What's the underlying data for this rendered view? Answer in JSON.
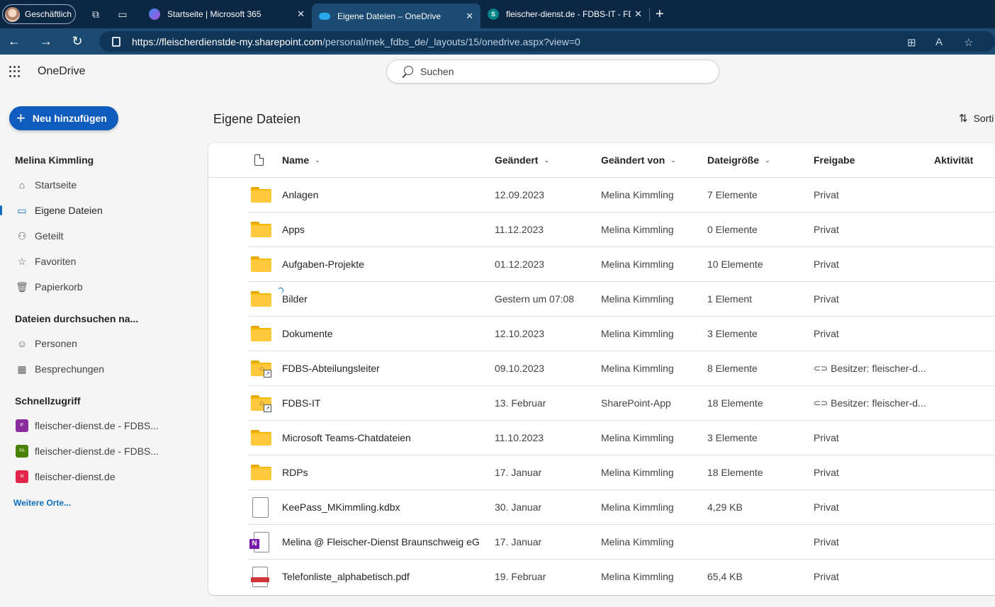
{
  "browser": {
    "profile_label": "Geschäftlich",
    "tabs": [
      {
        "title": "Startseite | Microsoft 365"
      },
      {
        "title": "Eigene Dateien – OneDrive"
      },
      {
        "title": "fleischer-dienst.de - FDBS-IT - FD"
      }
    ],
    "url_host": "https://fleischerdienstde-my.sharepoint.com",
    "url_path": "/personal/mek_fdbs_de/_layouts/15/onedrive.aspx?view=0"
  },
  "app": {
    "name": "OneDrive",
    "search_placeholder": "Suchen"
  },
  "sidebar": {
    "new_button": "Neu hinzufügen",
    "user_name": "Melina Kimmling",
    "items": [
      {
        "label": "Startseite",
        "icon": "home-icon"
      },
      {
        "label": "Eigene Dateien",
        "icon": "folder-icon",
        "active": true
      },
      {
        "label": "Geteilt",
        "icon": "people-icon"
      },
      {
        "label": "Favoriten",
        "icon": "star-icon"
      },
      {
        "label": "Papierkorb",
        "icon": "recycle-bin-icon"
      }
    ],
    "browse_header": "Dateien durchsuchen na...",
    "browse_items": [
      {
        "label": "Personen",
        "icon": "person-icon"
      },
      {
        "label": "Besprechungen",
        "icon": "calendar-icon"
      }
    ],
    "quick_header": "Schnellzugriff",
    "quick_items": [
      {
        "label": "fleischer-dienst.de - FDBS...",
        "badge": "fF",
        "color": "#8a2c9e"
      },
      {
        "label": "fleischer-dienst.de - FDBS...",
        "badge": "FA",
        "color": "#498205"
      },
      {
        "label": "fleischer-dienst.de",
        "badge": "fd",
        "color": "#e3244b"
      }
    ],
    "more_places": "Weitere Orte..."
  },
  "main": {
    "title": "Eigene Dateien",
    "sort_label": "Sorti",
    "columns": {
      "name": "Name",
      "modified": "Geändert",
      "modified_by": "Geändert von",
      "size": "Dateigröße",
      "sharing": "Freigabe",
      "activity": "Aktivität"
    },
    "files": [
      {
        "name": "Anlagen",
        "type": "folder",
        "modified": "12.09.2023",
        "by": "Melina Kimmling",
        "size": "7 Elemente",
        "sharing": "Privat"
      },
      {
        "name": "Apps",
        "type": "folder",
        "modified": "11.12.2023",
        "by": "Melina Kimmling",
        "size": "0 Elemente",
        "sharing": "Privat"
      },
      {
        "name": "Aufgaben-Projekte",
        "type": "folder",
        "modified": "01.12.2023",
        "by": "Melina Kimmling",
        "size": "10 Elemente",
        "sharing": "Privat"
      },
      {
        "name": "Bilder",
        "type": "folder",
        "modified": "Gestern um 07:08",
        "by": "Melina Kimmling",
        "size": "1 Element",
        "sharing": "Privat"
      },
      {
        "name": "Dokumente",
        "type": "folder",
        "modified": "12.10.2023",
        "by": "Melina Kimmling",
        "size": "3 Elemente",
        "sharing": "Privat"
      },
      {
        "name": "FDBS-Abteilungsleiter",
        "type": "shared-folder",
        "modified": "09.10.2023",
        "by": "Melina Kimmling",
        "size": "8 Elemente",
        "sharing": "Besitzer: fleischer-d..."
      },
      {
        "name": "FDBS-IT",
        "type": "shared-folder",
        "modified": "13. Februar",
        "by": "SharePoint-App",
        "size": "18 Elemente",
        "sharing": "Besitzer: fleischer-d..."
      },
      {
        "name": "Microsoft Teams-Chatdateien",
        "type": "folder",
        "modified": "11.10.2023",
        "by": "Melina Kimmling",
        "size": "3 Elemente",
        "sharing": "Privat"
      },
      {
        "name": "RDPs",
        "type": "folder",
        "modified": "17. Januar",
        "by": "Melina Kimmling",
        "size": "18 Elemente",
        "sharing": "Privat"
      },
      {
        "name": "KeePass_MKimmling.kdbx",
        "type": "file",
        "modified": "30. Januar",
        "by": "Melina Kimmling",
        "size": "4,29 KB",
        "sharing": "Privat"
      },
      {
        "name": "Melina @ Fleischer-Dienst Braunschweig eG",
        "type": "onenote",
        "modified": "17. Januar",
        "by": "Melina Kimmling",
        "size": "",
        "sharing": "Privat"
      },
      {
        "name": "Telefonliste_alphabetisch.pdf",
        "type": "pdf",
        "modified": "19. Februar",
        "by": "Melina Kimmling",
        "size": "65,4 KB",
        "sharing": "Privat"
      }
    ]
  }
}
